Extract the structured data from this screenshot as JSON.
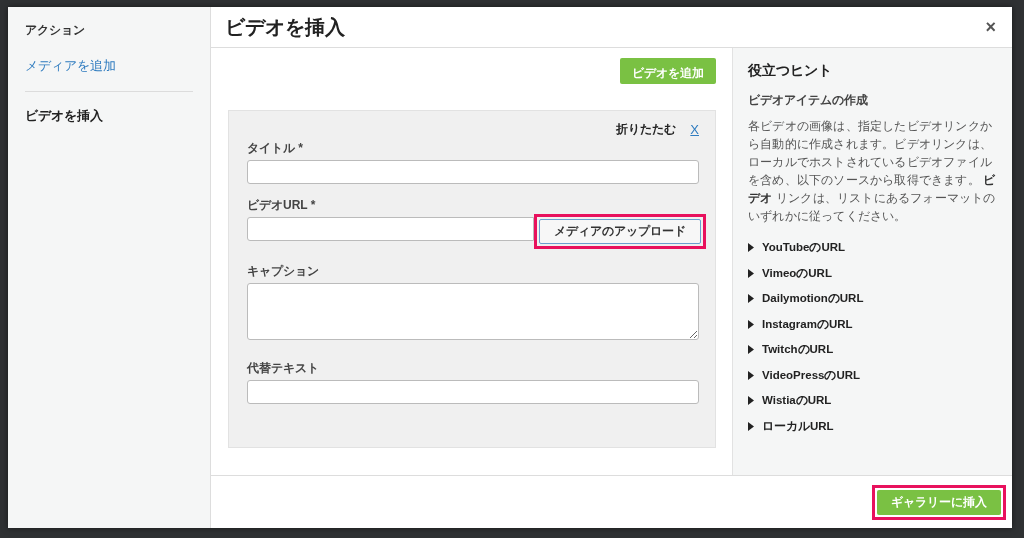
{
  "sidebar": {
    "heading": "アクション",
    "items": [
      {
        "label": "メディアを追加",
        "selected": false
      },
      {
        "label": "ビデオを挿入",
        "selected": true
      }
    ]
  },
  "dialog": {
    "title": "ビデオを挿入",
    "close": "×"
  },
  "add_video_button": {
    "label": "ビデオを追加"
  },
  "form": {
    "collapse_label": "折りたたむ",
    "collapse_link": "X",
    "fields": [
      {
        "label": "タイトル *",
        "kind": "input"
      },
      {
        "label": "ビデオURL *",
        "kind": "input",
        "button": {
          "label": "メディアのアップロード",
          "highlighted": true
        }
      },
      {
        "label": "キャプション",
        "kind": "textarea"
      },
      {
        "label": "代替テキスト",
        "kind": "input"
      }
    ]
  },
  "hints": {
    "title": "役立つヒント",
    "subtitle": "ビデオアイテムの作成",
    "text": "各ビデオの画像は、指定したビデオリンクから自動的に作成されます。ビデオリンクは、ローカルでホストされているビデオファイルを含め、以下のソースから取得できます。 **ビデオ** リンクは、リストにあるフォーマットのいずれかに従ってください。",
    "links": [
      {
        "label": "YouTubeのURL",
        "expanded": false
      },
      {
        "label": "VimeoのURL",
        "expanded": false
      },
      {
        "label": "DailymotionのURL",
        "expanded": false
      },
      {
        "label": "InstagramのURL",
        "expanded": false
      },
      {
        "label": "TwitchのURL",
        "expanded": false
      },
      {
        "label": "VideoPressのURL",
        "expanded": false
      },
      {
        "label": "WistiaのURL",
        "expanded": false
      },
      {
        "label": "ローカルURL",
        "expanded": false
      }
    ]
  },
  "footer": {
    "insert_button": {
      "label": "ギャラリーに挿入",
      "highlighted": true
    }
  }
}
